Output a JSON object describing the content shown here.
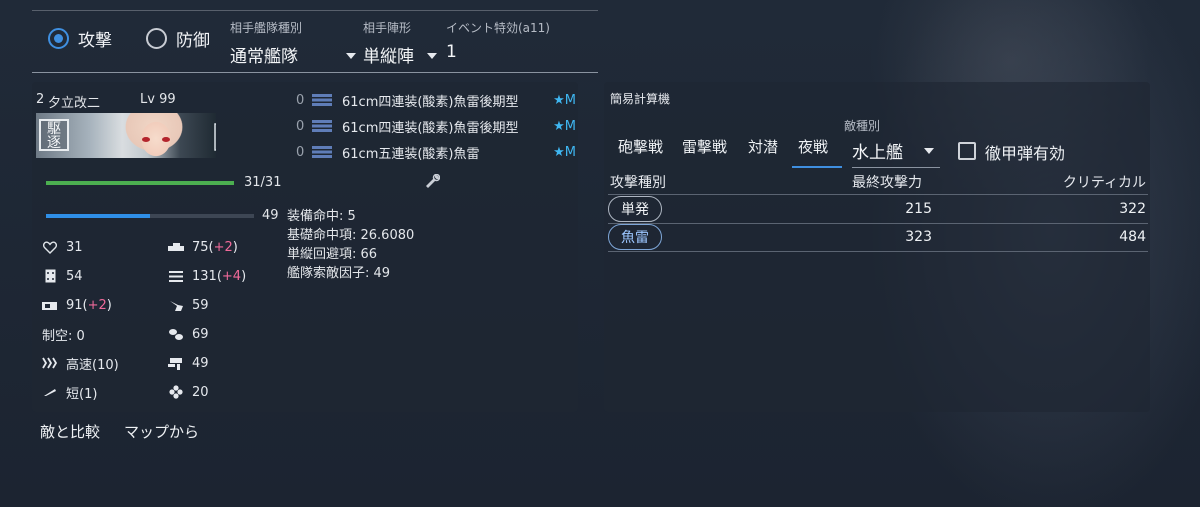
{
  "mode": {
    "attack_label": "攻撃",
    "defense_label": "防御",
    "selected": "attack"
  },
  "fields": {
    "enemy_fleet_type": {
      "label": "相手艦隊種別",
      "value": "通常艦隊"
    },
    "enemy_formation": {
      "label": "相手陣形",
      "value": "単縦陣"
    },
    "event_bonus": {
      "label": "イベント特効(a11)",
      "value": "1"
    }
  },
  "ship": {
    "index": "2",
    "name": "夕立改二",
    "level": "Lv 99",
    "type_badge": "駆逐",
    "hp": {
      "text": "31/31",
      "fraction": 1.0
    },
    "fuel": {
      "text": "49",
      "fraction": 0.5
    },
    "stats_left": [
      {
        "icon": "heart-icon",
        "value": "31",
        "bonus": ""
      },
      {
        "icon": "armor-icon",
        "value": "54",
        "bonus": ""
      },
      {
        "icon": "evasion-icon",
        "value": "91",
        "bonus": "+2"
      },
      {
        "icon": "",
        "value": "制空: 0",
        "bonus": ""
      },
      {
        "icon": "speed-icon",
        "value": "高速(10)",
        "bonus": ""
      },
      {
        "icon": "range-icon",
        "value": "短(1)",
        "bonus": ""
      }
    ],
    "stats_right": [
      {
        "icon": "firepower-icon",
        "value": "75",
        "bonus": "+2"
      },
      {
        "icon": "torpedo-icon",
        "value": "131",
        "bonus": "+4"
      },
      {
        "icon": "anti-air-icon",
        "value": "59",
        "bonus": ""
      },
      {
        "icon": "anti-sub-icon",
        "value": "69",
        "bonus": ""
      },
      {
        "icon": "los-icon",
        "value": "49",
        "bonus": ""
      },
      {
        "icon": "luck-icon",
        "value": "20",
        "bonus": ""
      }
    ],
    "equipment": [
      {
        "count": "0",
        "name": "61cm四連装(酸素)魚雷後期型",
        "proficiency": "★M"
      },
      {
        "count": "0",
        "name": "61cm四連装(酸素)魚雷後期型",
        "proficiency": "★M"
      },
      {
        "count": "0",
        "name": "61cm五連装(酸素)魚雷",
        "proficiency": "★M"
      }
    ],
    "accuracy": [
      "装備命中: 5",
      "基礎命中項: 26.6080",
      "単縦回避項: 66",
      "艦隊索敵因子: 49"
    ]
  },
  "calculator": {
    "title": "簡易計算機",
    "tabs": [
      "砲撃戦",
      "雷撃戦",
      "対潜",
      "夜戦"
    ],
    "active_tab": "夜戦",
    "enemy_type_label": "敵種別",
    "enemy_type_value": "水上艦",
    "ap_shell_label": "徹甲弾有効",
    "ap_shell_checked": false,
    "headers": {
      "attack_type": "攻撃種別",
      "final_power": "最終攻撃力",
      "critical": "クリティカル"
    },
    "rows": [
      {
        "attack_type": "単発",
        "final_power": "215",
        "critical": "322"
      },
      {
        "attack_type": "魚雷",
        "final_power": "323",
        "critical": "484"
      }
    ]
  },
  "links": {
    "compare": "敵と比較",
    "from_map": "マップから"
  },
  "colors": {
    "accent": "#3f8fe0",
    "hp_bar": "#4caf50",
    "fuel_bar": "#2f8fe8",
    "bonus": "#f06a9a",
    "proficiency": "#3fb7f2"
  }
}
